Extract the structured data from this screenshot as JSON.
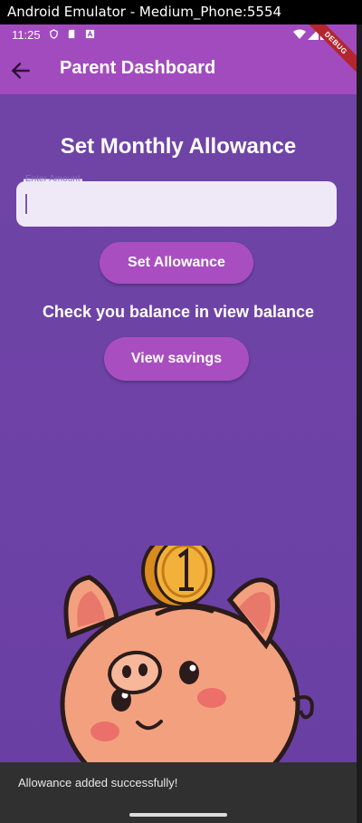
{
  "window": {
    "title": "Android Emulator - Medium_Phone:5554"
  },
  "status_bar": {
    "time": "11:25",
    "icons": [
      "shield-icon",
      "sd-card-icon",
      "a-icon",
      "wifi-icon",
      "signal-icon",
      "battery-icon"
    ]
  },
  "app_bar": {
    "title": "Parent Dashboard",
    "back_icon": "arrow-back-icon",
    "debug_label": "DEBUG"
  },
  "main": {
    "heading": "Set Monthly Allowance",
    "amount_field": {
      "label": "Enter Amount",
      "value": "",
      "placeholder": ""
    },
    "set_button": "Set Allowance",
    "info_text": "Check you balance in view balance",
    "view_button": "View savings",
    "illustration": "piggy-bank-with-coin"
  },
  "snackbar": {
    "message": "Allowance added successfully!"
  },
  "colors": {
    "app_bar": "#a24bbf",
    "background": "#6f45a8",
    "button": "#a94ec1",
    "snackbar": "#303030"
  }
}
